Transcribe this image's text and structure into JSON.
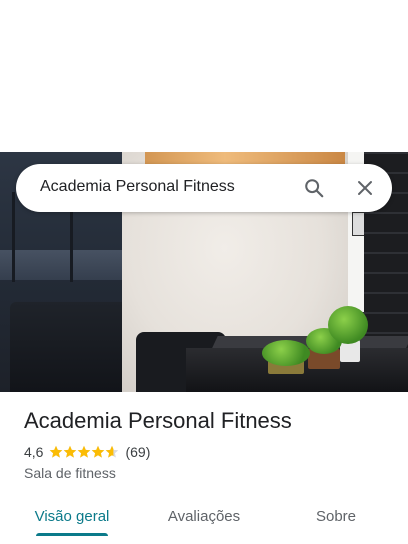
{
  "search": {
    "query": "Academia Personal Fitness",
    "search_icon": "search-icon",
    "clear_icon": "close-icon"
  },
  "photo": {
    "description_icon": "place-photo"
  },
  "place": {
    "name": "Academia Personal Fitness",
    "rating": "4,6",
    "rating_value": 4.6,
    "stars_filled": 4.6,
    "review_count": "(69)",
    "category": "Sala de fitness"
  },
  "tabs": [
    {
      "label": "Visão geral",
      "active": true
    },
    {
      "label": "Avaliações",
      "active": false
    },
    {
      "label": "Sobre",
      "active": false
    }
  ],
  "colors": {
    "accent": "#0b7a8a",
    "star": "#fbbc04",
    "text_primary": "#202124",
    "text_secondary": "#5f6368"
  }
}
